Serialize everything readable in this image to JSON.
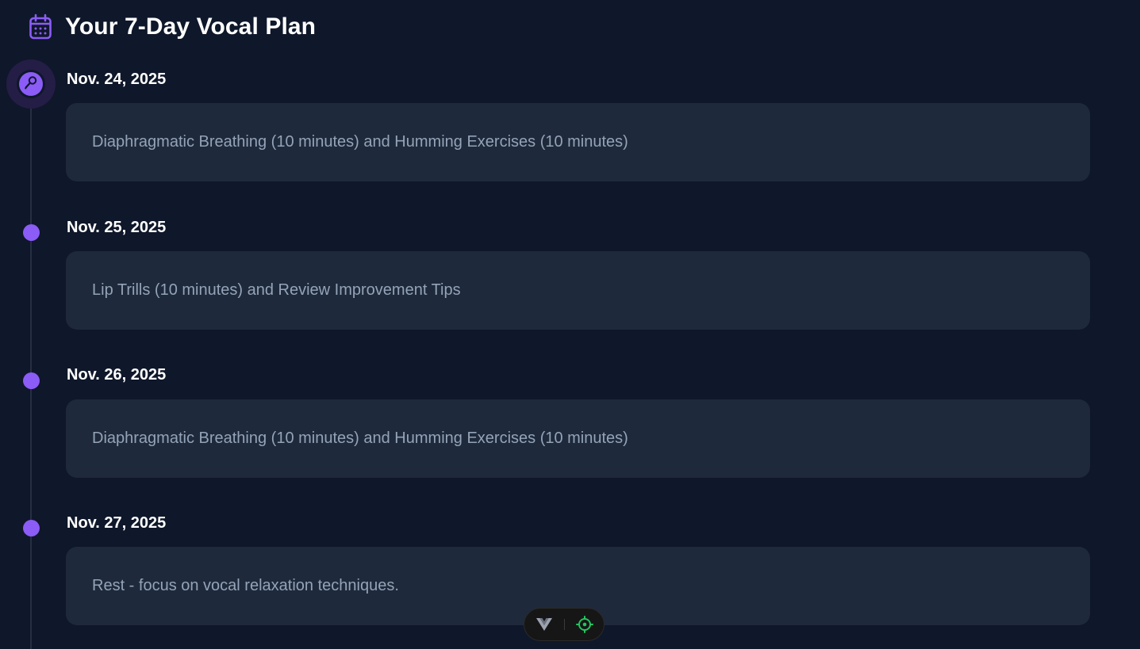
{
  "header": {
    "title": "Your 7-Day Vocal Plan",
    "icon": "calendar-icon",
    "icon_color": "#8b5cf6"
  },
  "timeline": {
    "accent_color": "#8b5cf6",
    "active_icon": "microphone-icon",
    "days": [
      {
        "date": "Nov. 24, 2025",
        "task": "Diaphragmatic Breathing (10 minutes) and Humming Exercises (10 minutes)",
        "active": true
      },
      {
        "date": "Nov. 25, 2025",
        "task": "Lip Trills (10 minutes) and Review Improvement Tips",
        "active": false
      },
      {
        "date": "Nov. 26, 2025",
        "task": "Diaphragmatic Breathing (10 minutes) and Humming Exercises (10 minutes)",
        "active": false
      },
      {
        "date": "Nov. 27, 2025",
        "task": "Rest - focus on vocal relaxation techniques.",
        "active": false
      }
    ]
  },
  "dev_toolbar": {
    "left_icon": "vue-logo-icon",
    "right_icon": "target-icon",
    "right_icon_color": "#22c55e"
  }
}
